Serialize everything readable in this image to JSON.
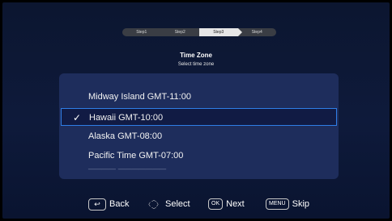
{
  "stepper": {
    "steps": [
      "Step1",
      "Step2",
      "Step3",
      "Step4"
    ],
    "active_index": 2
  },
  "header": {
    "title": "Time Zone",
    "subtitle": "Select time zone"
  },
  "timezones": {
    "items": [
      {
        "label": "Midway Island GMT-11:00",
        "selected": false
      },
      {
        "label": "Hawaii GMT-10:00",
        "selected": true
      },
      {
        "label": "Alaska GMT-08:00",
        "selected": false
      },
      {
        "label": "Pacific Time GMT-07:00",
        "selected": false
      }
    ]
  },
  "footer": {
    "back_label": "Back",
    "select_label": "Select",
    "ok_key": "OK",
    "next_label": "Next",
    "menu_key": "MENU",
    "skip_label": "Skip"
  },
  "icons": {
    "back": "back-arrow-icon",
    "dpad": "dpad-icon",
    "check": "checkmark-icon"
  },
  "colors": {
    "background": "#0e1a3b",
    "panel": "#1e2d5c",
    "selection_border": "#2f7ee6",
    "selection_fill": "#111b44"
  }
}
